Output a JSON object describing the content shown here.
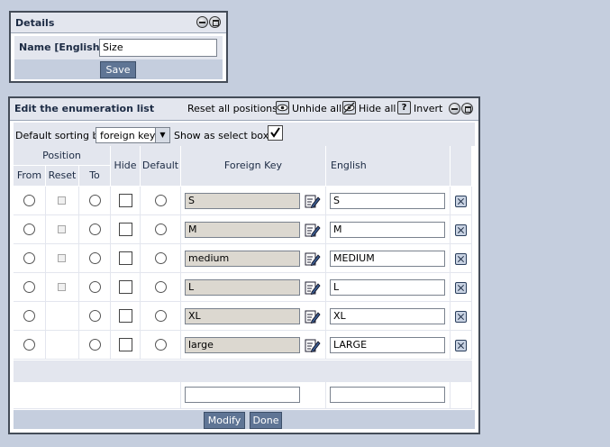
{
  "details": {
    "title": "Details",
    "name_label": "Name [English]",
    "name_value": "Size",
    "save_label": "Save"
  },
  "enum": {
    "title": "Edit the enumeration list",
    "toolbar": {
      "reset_all": "Reset all positions",
      "unhide_all": "Unhide all",
      "hide_all": "Hide all",
      "invert": "Invert"
    },
    "sorting_label": "Default sorting by",
    "sorting_value": "foreign key",
    "select_box_label": "Show as select box",
    "select_box_checked": true,
    "headers": {
      "position": "Position",
      "from": "From",
      "reset": "Reset",
      "to": "To",
      "hide": "Hide",
      "default": "Default",
      "foreign_key": "Foreign Key",
      "english": "English"
    },
    "rows": [
      {
        "foreign_key": "S",
        "english": "S",
        "has_reset": true
      },
      {
        "foreign_key": "M",
        "english": "M",
        "has_reset": true
      },
      {
        "foreign_key": "medium",
        "english": "MEDIUM",
        "has_reset": true
      },
      {
        "foreign_key": "L",
        "english": "L",
        "has_reset": true
      },
      {
        "foreign_key": "XL",
        "english": "XL",
        "has_reset": false
      },
      {
        "foreign_key": "large",
        "english": "LARGE",
        "has_reset": false
      }
    ],
    "new_row": {
      "foreign_key": "",
      "english": ""
    },
    "modify_label": "Modify",
    "done_label": "Done"
  },
  "icons": {
    "minimize": "minimize-icon",
    "maximize": "maximize-icon",
    "unhide": "eye-icon",
    "hide": "eye-crossed-icon",
    "invert": "question-icon",
    "edit": "edit-pencil-icon",
    "delete": "delete-x-icon"
  }
}
